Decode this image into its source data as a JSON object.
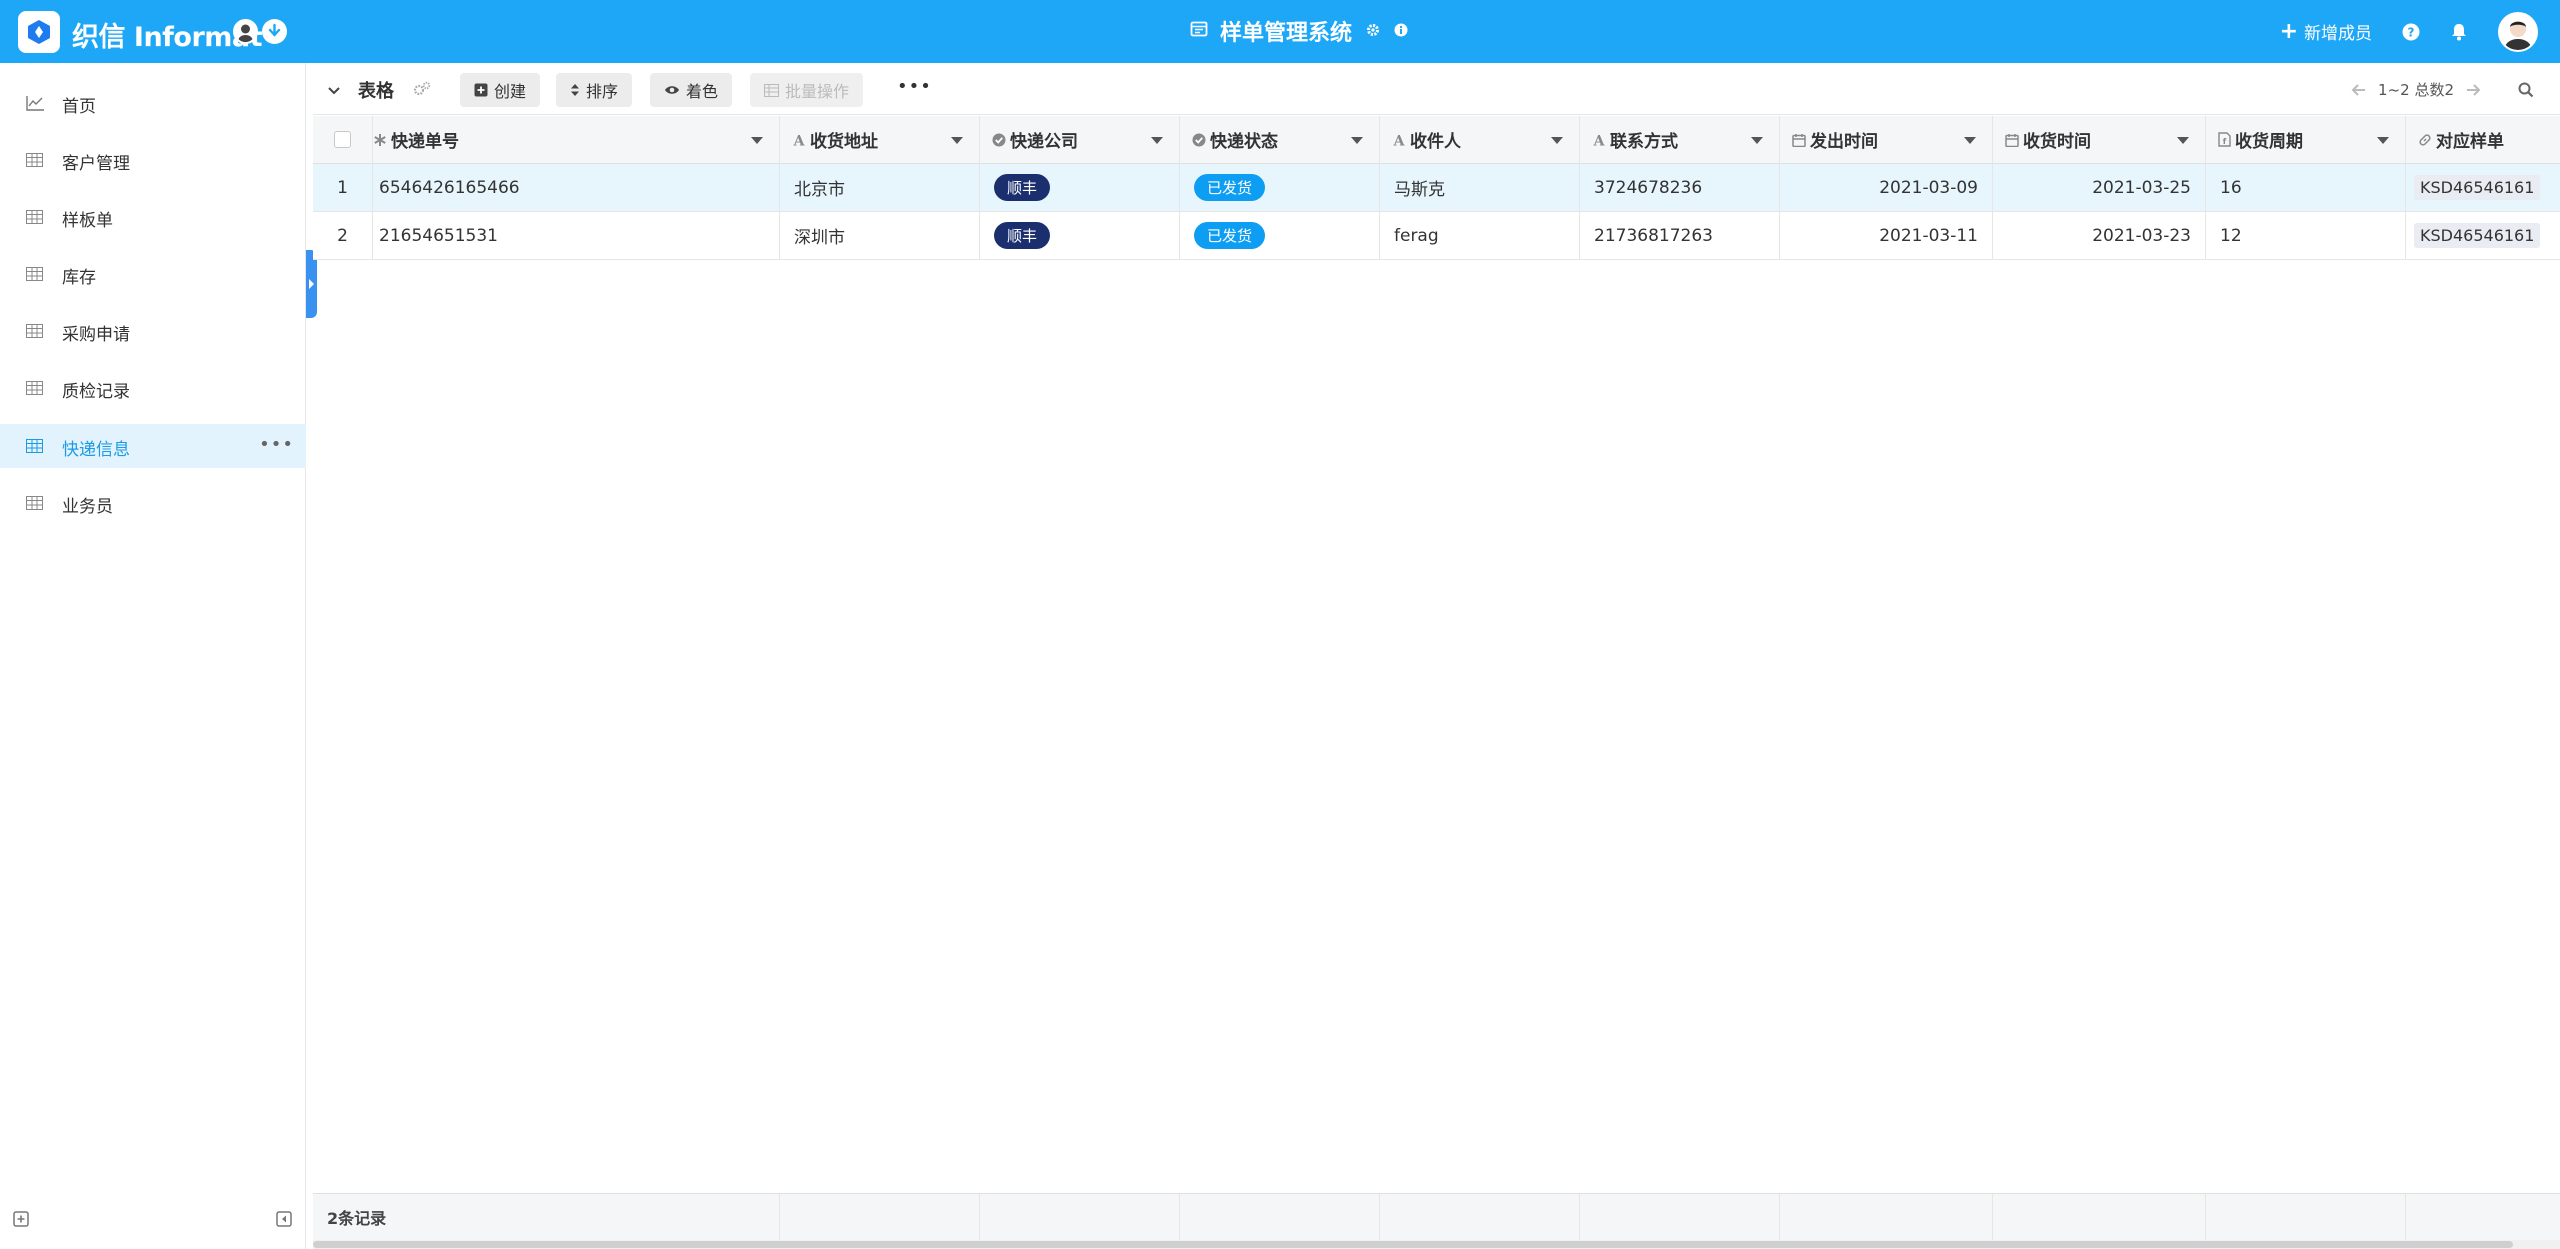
{
  "topbar": {
    "app_name": "织信 Informat",
    "system_title": "样单管理系统",
    "add_member_label": "新增成员",
    "accent_color": "#1ea7f7"
  },
  "sidebar": {
    "items": [
      {
        "label": "首页",
        "icon": "chart-line-icon"
      },
      {
        "label": "客户管理",
        "icon": "table-icon"
      },
      {
        "label": "样板单",
        "icon": "table-icon"
      },
      {
        "label": "库存",
        "icon": "table-icon"
      },
      {
        "label": "采购申请",
        "icon": "table-icon"
      },
      {
        "label": "质检记录",
        "icon": "table-icon"
      },
      {
        "label": "快递信息",
        "icon": "table-icon",
        "active": true
      },
      {
        "label": "业务员",
        "icon": "table-icon"
      }
    ],
    "more_label": "•••"
  },
  "toolbar": {
    "view_name": "表格",
    "create_label": "创建",
    "sort_label": "排序",
    "color_label": "着色",
    "batch_label": "批量操作",
    "more_label": "•••",
    "pager_text": "1~2 总数2"
  },
  "table": {
    "columns": [
      {
        "label": "快递单号",
        "icon": "asterisk-icon"
      },
      {
        "label": "收货地址",
        "icon": "text-icon"
      },
      {
        "label": "快递公司",
        "icon": "check-circle-icon"
      },
      {
        "label": "快递状态",
        "icon": "check-circle-icon"
      },
      {
        "label": "收件人",
        "icon": "text-icon"
      },
      {
        "label": "联系方式",
        "icon": "text-icon"
      },
      {
        "label": "发出时间",
        "icon": "calendar-icon"
      },
      {
        "label": "收货时间",
        "icon": "calendar-icon"
      },
      {
        "label": "收货周期",
        "icon": "formula-icon"
      },
      {
        "label": "对应样单",
        "icon": "link-icon"
      }
    ],
    "rows": [
      {
        "no": "1",
        "tracking_no": "6546426165466",
        "address": "北京市",
        "company": "顺丰",
        "status": "已发货",
        "recipient": "马斯克",
        "phone": "3724678236",
        "sent": "2021-03-09",
        "received": "2021-03-25",
        "cycle": "16",
        "sample": "KSD46546161"
      },
      {
        "no": "2",
        "tracking_no": "21654651531",
        "address": "深圳市",
        "company": "顺丰",
        "status": "已发货",
        "recipient": "ferag",
        "phone": "21736817263",
        "sent": "2021-03-11",
        "received": "2021-03-23",
        "cycle": "12",
        "sample": "KSD46546161"
      }
    ],
    "footer_count": "2条记录"
  },
  "colors": {
    "company_tag": "#1b2f6e",
    "status_tag": "#0d9ef3",
    "active_nav_bg": "#e3f3fd",
    "active_nav_text": "#1a9be6"
  }
}
